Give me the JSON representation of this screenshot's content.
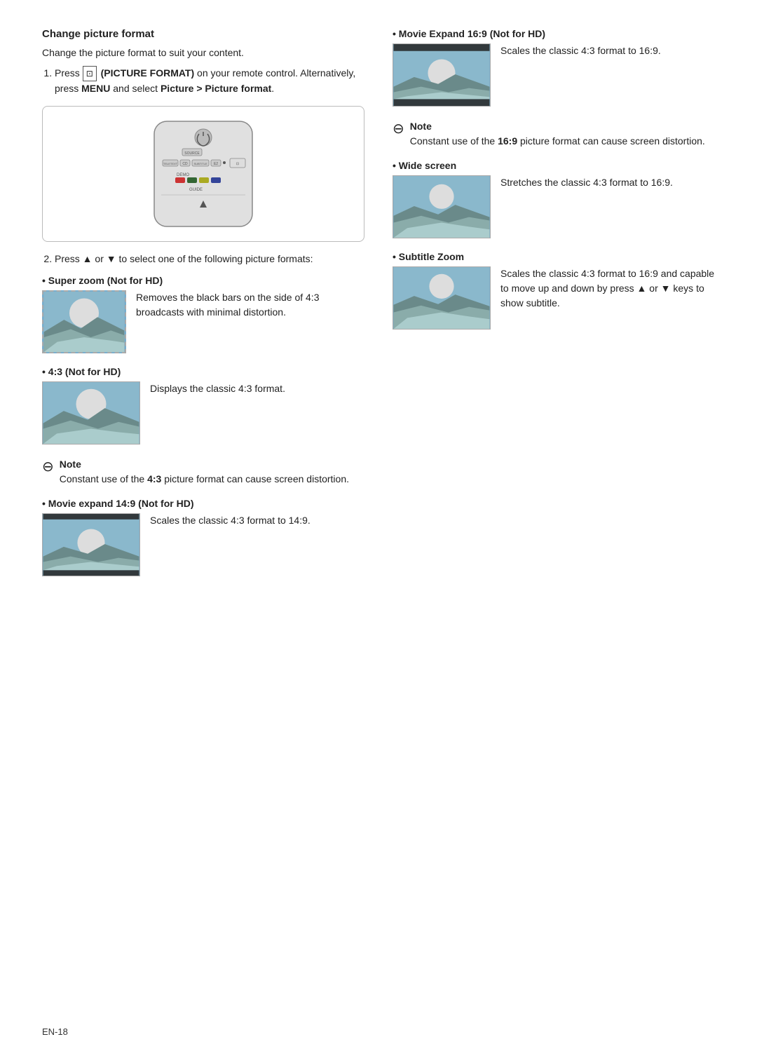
{
  "page": {
    "number": "EN-18"
  },
  "heading": "Change picture format",
  "intro": "Change the picture format to suit your content.",
  "steps": [
    {
      "id": "step1",
      "text": "Press  (PICTURE FORMAT) on your remote control. Alternatively, press MENU and select Picture > Picture format."
    },
    {
      "id": "step2",
      "text": "Press ▲ or ▼ to select one of the following picture formats:"
    }
  ],
  "formats_left": [
    {
      "id": "super-zoom",
      "label": "Super zoom (Not for HD)",
      "desc": "Removes the black bars on the side of 4:3 broadcasts with minimal distortion.",
      "type": "super"
    },
    {
      "id": "4-3",
      "label": "4:3 (Not for HD)",
      "desc": "Displays the classic 4:3 format.",
      "type": "classic"
    }
  ],
  "note_left": {
    "text_before": "Constant use of the ",
    "highlight": "4:3",
    "text_after": " picture format can cause screen distortion."
  },
  "formats_left2": [
    {
      "id": "movie-expand-14-9",
      "label": "Movie expand 14:9 (Not for HD)",
      "desc": "Scales the classic 4:3 format to 14:9.",
      "type": "wide14"
    }
  ],
  "formats_right": [
    {
      "id": "movie-expand-16-9",
      "label": "Movie Expand 16:9 (Not for HD)",
      "desc": "Scales the classic 4:3 format to 16:9.",
      "type": "wide16"
    }
  ],
  "note_right": {
    "text_before": "Constant use of the ",
    "highlight": "16:9",
    "text_after": " picture format can cause screen distortion."
  },
  "formats_right2": [
    {
      "id": "wide-screen",
      "label": "Wide screen",
      "desc": "Stretches the classic 4:3 format to 16:9.",
      "type": "wide16"
    },
    {
      "id": "subtitle-zoom",
      "label": "Subtitle Zoom",
      "desc": "Scales the classic 4:3 format to 16:9 and capable to move up and down by press ▲ or ▼ keys to show subtitle.",
      "type": "wide16"
    }
  ]
}
